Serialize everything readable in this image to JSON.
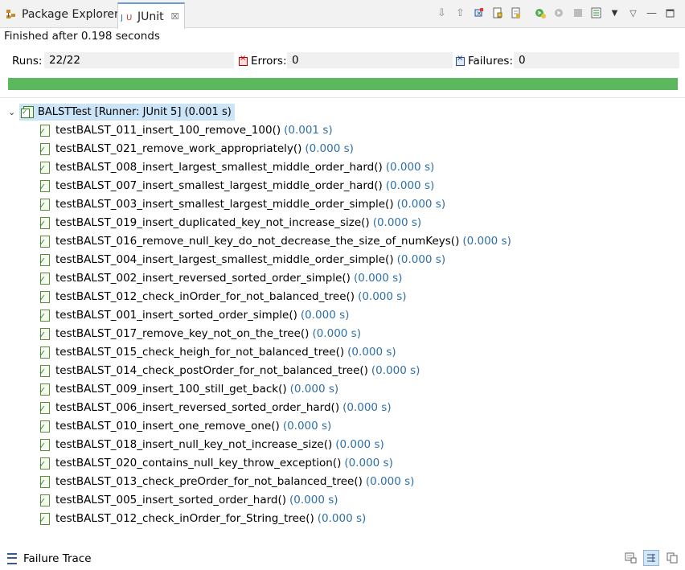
{
  "tabs": [
    {
      "label": "Package Explorer",
      "icon": "package-explorer-icon"
    },
    {
      "label": "JUnit",
      "icon": "junit-icon",
      "close": "☒"
    }
  ],
  "toolbar": {
    "icons": [
      "next-failure-icon",
      "previous-failure-icon",
      "show-failures-only-icon",
      "scroll-lock-icon",
      "show-skipped-icon",
      "rerun-test-icon",
      "rerun-failed-first-icon",
      "stop-icon",
      "test-run-history-icon",
      "dropdown-arrow-icon",
      "view-menu-icon",
      "minimize-icon",
      "maximize-icon"
    ]
  },
  "status": "Finished after 0.198 seconds",
  "counters": {
    "runs_label": "Runs:",
    "runs_value": "22/22",
    "errors_label": "Errors:",
    "errors_value": "0",
    "failures_label": "Failures:",
    "failures_value": "0"
  },
  "progress": {
    "fraction": 1.0,
    "color": "#5cb85c"
  },
  "suite": {
    "label": "BALSTTest [Runner: JUnit 5] (0.001 s)"
  },
  "tests": [
    {
      "name": "testBALST_011_insert_100_remove_100()",
      "time": "(0.001 s)"
    },
    {
      "name": "testBALST_021_remove_work_appropriately()",
      "time": "(0.000 s)"
    },
    {
      "name": "testBALST_008_insert_largest_smallest_middle_order_hard()",
      "time": "(0.000 s)"
    },
    {
      "name": "testBALST_007_insert_smallest_largest_middle_order_hard()",
      "time": "(0.000 s)"
    },
    {
      "name": "testBALST_003_insert_smallest_largest_middle_order_simple()",
      "time": "(0.000 s)"
    },
    {
      "name": "testBALST_019_insert_duplicated_key_not_increase_size()",
      "time": "(0.000 s)"
    },
    {
      "name": "testBALST_016_remove_null_key_do_not_decrease_the_size_of_numKeys()",
      "time": "(0.000 s)"
    },
    {
      "name": "testBALST_004_insert_largest_smallest_middle_order_simple()",
      "time": "(0.000 s)"
    },
    {
      "name": "testBALST_002_insert_reversed_sorted_order_simple()",
      "time": "(0.000 s)"
    },
    {
      "name": "testBALST_012_check_inOrder_for_not_balanced_tree()",
      "time": "(0.000 s)"
    },
    {
      "name": "testBALST_001_insert_sorted_order_simple()",
      "time": "(0.000 s)"
    },
    {
      "name": "testBALST_017_remove_key_not_on_the_tree()",
      "time": "(0.000 s)"
    },
    {
      "name": "testBALST_015_check_heigh_for_not_balanced_tree()",
      "time": "(0.000 s)"
    },
    {
      "name": "testBALST_014_check_postOrder_for_not_balanced_tree()",
      "time": "(0.000 s)"
    },
    {
      "name": "testBALST_009_insert_100_still_get_back()",
      "time": "(0.000 s)"
    },
    {
      "name": "testBALST_006_insert_reversed_sorted_order_hard()",
      "time": "(0.000 s)"
    },
    {
      "name": "testBALST_010_insert_one_remove_one()",
      "time": "(0.000 s)"
    },
    {
      "name": "testBALST_018_insert_null_key_not_increase_size()",
      "time": "(0.000 s)"
    },
    {
      "name": "testBALST_020_contains_null_key_throw_exception()",
      "time": "(0.000 s)"
    },
    {
      "name": "testBALST_013_check_preOrder_for_not_balanced_tree()",
      "time": "(0.000 s)"
    },
    {
      "name": "testBALST_005_insert_sorted_order_hard()",
      "time": "(0.000 s)"
    },
    {
      "name": "testBALST_012_check_inOrder_for_String_tree()",
      "time": "(0.000 s)"
    }
  ],
  "failure_trace": {
    "label": "Failure Trace"
  }
}
